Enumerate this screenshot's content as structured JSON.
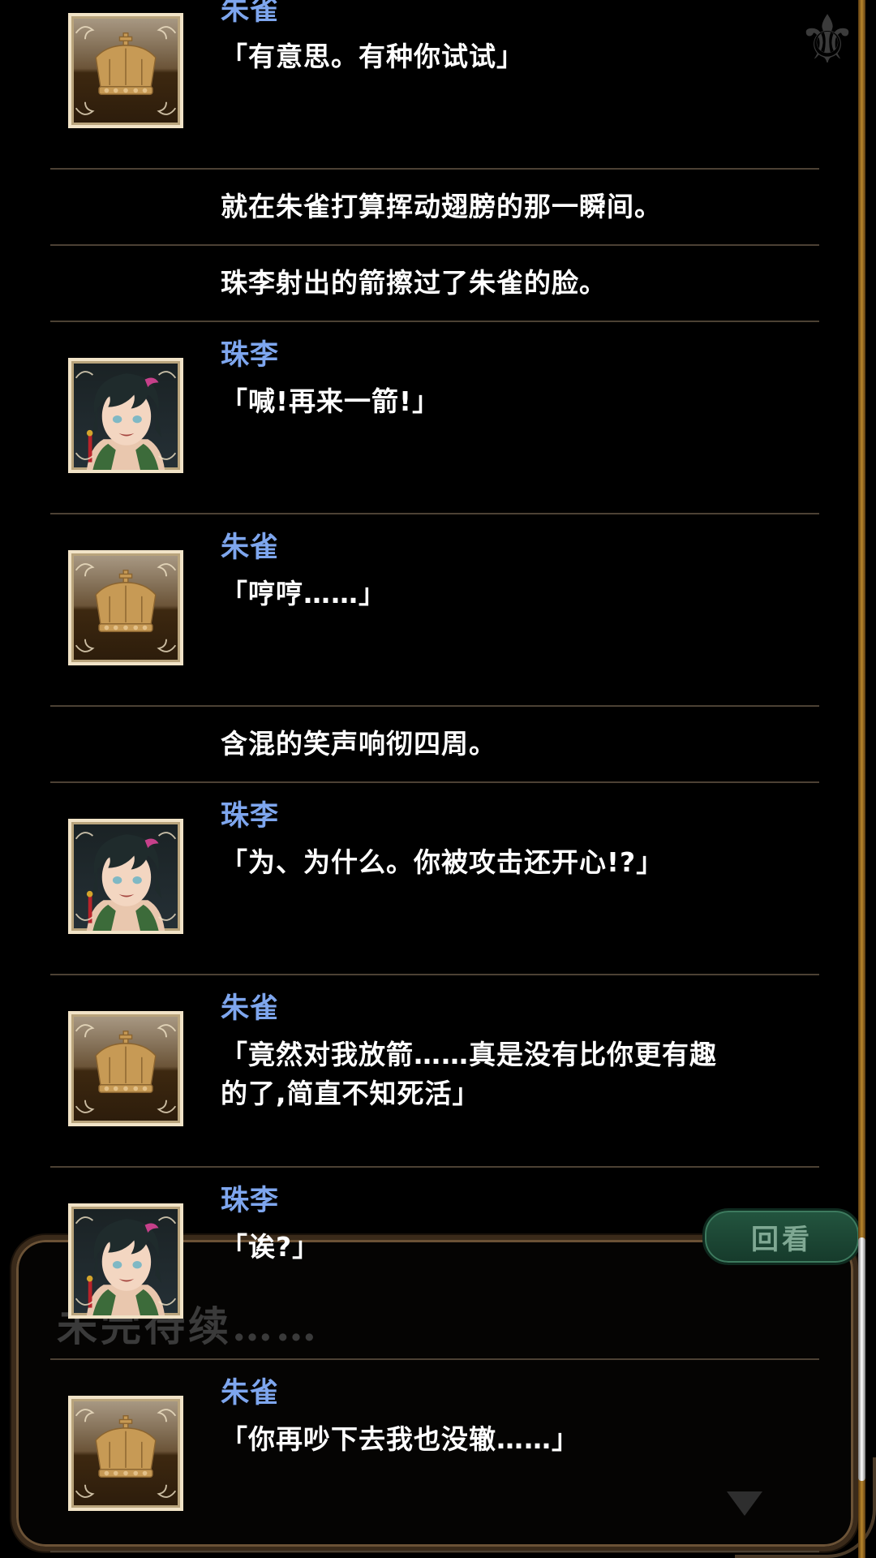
{
  "background": {
    "continue_text": "未完待续……",
    "review_button_label": "回看",
    "fleur_icon": "fleur-de-lis-icon"
  },
  "log": [
    {
      "type": "dialog",
      "speaker": "朱雀",
      "avatar": "crown",
      "text": "「有意思。有种你试试」"
    },
    {
      "type": "narration",
      "text": "就在朱雀打算挥动翅膀的那一瞬间。"
    },
    {
      "type": "narration",
      "text": "珠李射出的箭擦过了朱雀的脸。"
    },
    {
      "type": "dialog",
      "speaker": "珠李",
      "avatar": "boy",
      "text": "「喊!再来一箭!」"
    },
    {
      "type": "dialog",
      "speaker": "朱雀",
      "avatar": "crown",
      "text": "「哼哼……」"
    },
    {
      "type": "narration",
      "text": "含混的笑声响彻四周。"
    },
    {
      "type": "dialog",
      "speaker": "珠李",
      "avatar": "boy",
      "text": "「为、为什么。你被攻击还开心!?」"
    },
    {
      "type": "dialog",
      "speaker": "朱雀",
      "avatar": "crown",
      "text": "「竟然对我放箭……真是没有比你更有趣的了,简直不知死活」"
    },
    {
      "type": "dialog",
      "speaker": "珠李",
      "avatar": "boy",
      "text": "「诶?」"
    },
    {
      "type": "dialog",
      "speaker": "朱雀",
      "avatar": "crown",
      "text": "「你再吵下去我也没辙……」"
    }
  ],
  "colors": {
    "speaker_name": "#7ea6ee",
    "divider": "#4c4134",
    "scroll_track": "#b8862c"
  }
}
